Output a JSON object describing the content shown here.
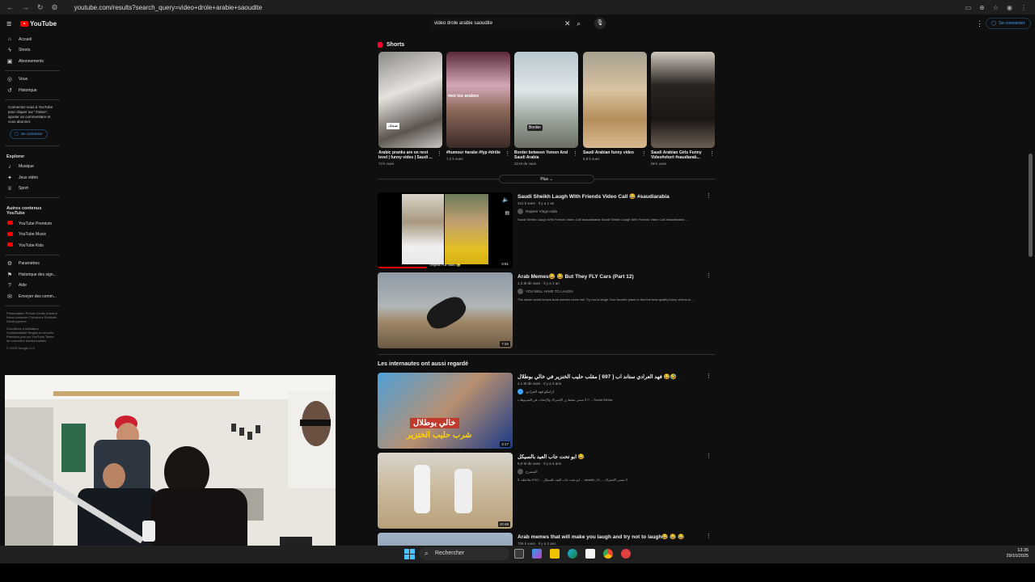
{
  "browser": {
    "url": "youtube.com/results?search_query=video+drole+arabie+saoudite"
  },
  "header": {
    "logo_text": "YouTube",
    "search_value": "video drole arabie saoudite",
    "signin_label": "Se connecter"
  },
  "sidebar": {
    "main": [
      {
        "label": "Accueil",
        "icon": "home-icon"
      },
      {
        "label": "Shorts",
        "icon": "shorts-icon"
      },
      {
        "label": "Abonnements",
        "icon": "subscriptions-icon"
      }
    ],
    "you": [
      {
        "label": "Vous",
        "icon": "you-icon"
      },
      {
        "label": "Historique",
        "icon": "history-icon"
      }
    ],
    "signin_note": "Connectez-vous à YouTube pour cliquer sur \"J'aime\", ajouter un commentaire et vous abonner.",
    "signin_label": "Se connecter",
    "explore_title": "Explorer",
    "explore": [
      {
        "label": "Musique",
        "icon": "music-icon"
      },
      {
        "label": "Jeux vidéo",
        "icon": "gaming-icon"
      },
      {
        "label": "Sport",
        "icon": "sport-icon"
      }
    ],
    "more_title": "Autres contenus YouTube",
    "more": [
      {
        "label": "YouTube Premium"
      },
      {
        "label": "YouTube Music"
      },
      {
        "label": "YouTube Kids"
      }
    ],
    "settings": [
      {
        "label": "Paramètres",
        "icon": "settings-icon"
      },
      {
        "label": "Historique des sign...",
        "icon": "flag-icon"
      },
      {
        "label": "Aide",
        "icon": "help-icon"
      },
      {
        "label": "Envoyer des comm...",
        "icon": "feedback-icon"
      }
    ],
    "footer1": "Présentation  Presse  Droits d'auteur  Nous contacter  Créateurs  Publicité  Développeurs",
    "footer2": "Conditions d'utilisation  Confidentialité  Règles et sécurité  Premiers pas sur YouTube  Tester de nouvelles fonctionnalités",
    "copyright": "© 2025 Google LLC"
  },
  "shorts": {
    "title": "Shorts",
    "items": [
      {
        "caption": "Arabic pranks are on next level | funny video | Saudi ...",
        "views": "72 k vues",
        "overlay": "ضحك"
      },
      {
        "caption": "#humour #arabe #fyp #drôle",
        "views": "7,2 k vues",
        "overlay": "moi les arabes"
      },
      {
        "caption": "Border between Yemen And Saudi Arabia",
        "views": "33 M de vues",
        "overlay": "Border"
      },
      {
        "caption": "Saudi Arabian funny video",
        "views": "5,8 k vues",
        "overlay": ""
      },
      {
        "caption": "Saudi Arabian Girls Funny Video#short #saudiarab...",
        "views": "59 k vues",
        "overlay": ""
      }
    ],
    "plus_label": "Plus"
  },
  "videos": [
    {
      "title": "Saudi Sheikh Laugh With Friends Video Call 😂 #saudiarabia",
      "meta": "341 k vues · Il y a 1 an",
      "channel": "Rajveer Vlogs India",
      "desc": "Saudi Sheikh Laugh With Friends Video Call #saudiarabia Saudi Sheikh Laugh With Friends Video Call #saudiarabia ...",
      "duration": "0:51",
      "thumb_caption": "Original Full Video 😂"
    },
    {
      "title": "Arab Memes😂 😂 But They FLY Cars (Part 12)",
      "meta": "1,3 M de vues · Il y a 1 an",
      "channel": "YOU WILL HAVE TO LAUGH",
      "desc": "The whole world knows Arab memes never fail. Try not to laugh Your favorite place to find the best quality funny videos to ...",
      "duration": "7:32"
    }
  ],
  "related": {
    "title": "Les internautes ont aussi regardé",
    "items": [
      {
        "title": "فهد العرادي ستاند اب [ 697 ] مقلب حليب الخنزير في خالي بوطلال 😂🤣",
        "meta": "4,1 M de vues · Il y a 3 ans",
        "channel": "ارامكو فهد العرادي",
        "desc": "لا تنسى ضغط زر الإشتراك والإعجاب في الفيديوهات !! ... Social Media",
        "duration": "3:17",
        "thumb_text1": "خالي بوطلال",
        "thumb_text2": "شرب حليب الخنزير"
      },
      {
        "title": "ابو تحت جاب العيد بالسيكل 😂",
        "meta": "5,6 M de vues · Il y a 4 ans",
        "channel": "المسرح",
        "desc": "ملاحظه: لا EXO ... ابو تحت جاب العيد بالسيكل ... alotaibi_21 ... لا تنسى الاشتراك",
        "duration": "10:46"
      },
      {
        "title": "Arab memes that will make you laugh and try not to laugh😂 😂 😂",
        "meta": "726 k vues · Il y a 2 ans",
        "channel": "",
        "desc": "",
        "duration": ""
      }
    ]
  },
  "taskbar": {
    "search_label": "Rechercher",
    "time": "13:35",
    "date": "29/10/2025"
  }
}
